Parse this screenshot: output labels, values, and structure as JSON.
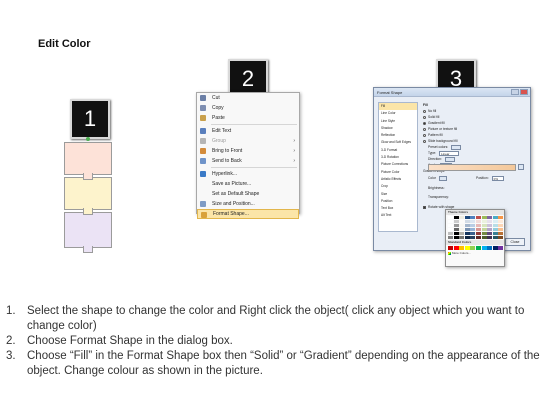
{
  "title": "Edit Color",
  "step_numbers": [
    "1",
    "2",
    "3"
  ],
  "context_menu": {
    "items": [
      {
        "label": "Cut",
        "icon": "scissors-icon",
        "color": "#6b7fa6",
        "disabled": false
      },
      {
        "label": "Copy",
        "icon": "copy-icon",
        "color": "#7d8db0",
        "disabled": false
      },
      {
        "label": "Paste",
        "icon": "clipboard-icon",
        "color": "#c9a04b",
        "disabled": false
      },
      {
        "label": "Edit Text",
        "icon": "edit-text-icon",
        "color": "#5a7fbd",
        "disabled": false
      },
      {
        "label": "Group",
        "icon": "group-icon",
        "color": "#b5b5b5",
        "disabled": true,
        "submenu": true
      },
      {
        "label": "Bring to Front",
        "icon": "bring-front-icon",
        "color": "#d38b3a",
        "disabled": false,
        "submenu": true
      },
      {
        "label": "Send to Back",
        "icon": "send-back-icon",
        "color": "#6f93c9",
        "disabled": false,
        "submenu": true
      },
      {
        "label": "Hyperlink...",
        "icon": "hyperlink-icon",
        "color": "#3a7ac7",
        "disabled": false
      },
      {
        "label": "Save as Picture...",
        "icon": "",
        "color": "",
        "disabled": false
      },
      {
        "label": "Set as Default Shape",
        "icon": "",
        "color": "",
        "disabled": false
      },
      {
        "label": "Size and Position...",
        "icon": "size-position-icon",
        "color": "#7f9bc4",
        "disabled": false
      },
      {
        "label": "Format Shape...",
        "icon": "format-shape-icon",
        "color": "#d9a23a",
        "disabled": false,
        "highlighted": true
      }
    ]
  },
  "dialog": {
    "title": "Format Shape",
    "nav_items": [
      "Fill",
      "Line Color",
      "Line Style",
      "Shadow",
      "Reflection",
      "Glow and Soft Edges",
      "3-D Format",
      "3-D Rotation",
      "Picture Corrections",
      "Picture Color",
      "Artistic Effects",
      "Crop",
      "Size",
      "Position",
      "Text Box",
      "Alt Text"
    ],
    "fill_heading": "Fill",
    "fill_options": [
      {
        "label": "No fill",
        "selected": false
      },
      {
        "label": "Solid fill",
        "selected": false
      },
      {
        "label": "Gradient fill",
        "selected": true
      },
      {
        "label": "Picture or texture fill",
        "selected": false
      },
      {
        "label": "Pattern fill",
        "selected": false
      },
      {
        "label": "Slide background fill",
        "selected": false
      }
    ],
    "preset_colors_label": "Preset colors:",
    "type_label": "Type:",
    "type_value": "Linear",
    "direction_label": "Direction:",
    "angle_label": "Angle:",
    "angle_value": "90°",
    "gradient_stops_label": "Gradient stops",
    "color_label": "Color",
    "position_label": "Position:",
    "position_value": "0%",
    "brightness_label": "Brightness:",
    "transparency_label": "Transparency:",
    "rotate_label": "Rotate with shape",
    "close_label": "Close"
  },
  "palette": {
    "theme_heading": "Theme Colors",
    "standard_heading": "Standard Colors",
    "more_label": "More Colors...",
    "theme_top": [
      "#ffffff",
      "#000000",
      "#eeece1",
      "#1f497d",
      "#4f81bd",
      "#c0504d",
      "#9bbb59",
      "#8064a2",
      "#4bacc6",
      "#f79646"
    ],
    "standard": [
      "#c00000",
      "#ff0000",
      "#ffc000",
      "#ffff00",
      "#92d050",
      "#00b050",
      "#00b0f0",
      "#0070c0",
      "#002060",
      "#7030a0"
    ]
  },
  "shape_colors": {
    "top": "#fde2d8",
    "middle": "#fdf3cc",
    "bottom": "#ebe3f5"
  },
  "instructions": [
    {
      "num": "1.",
      "text": "Select the shape to change the color and Right click the object( click any object which you want to change color)"
    },
    {
      "num": "2.",
      "text": "Choose Format Shape in the dialog box."
    },
    {
      "num": "3.",
      "text": "Choose “Fill” in the Format Shape box then “Solid” or “Gradient” depending on the appearance of the object. Change colour as shown in the picture."
    }
  ]
}
